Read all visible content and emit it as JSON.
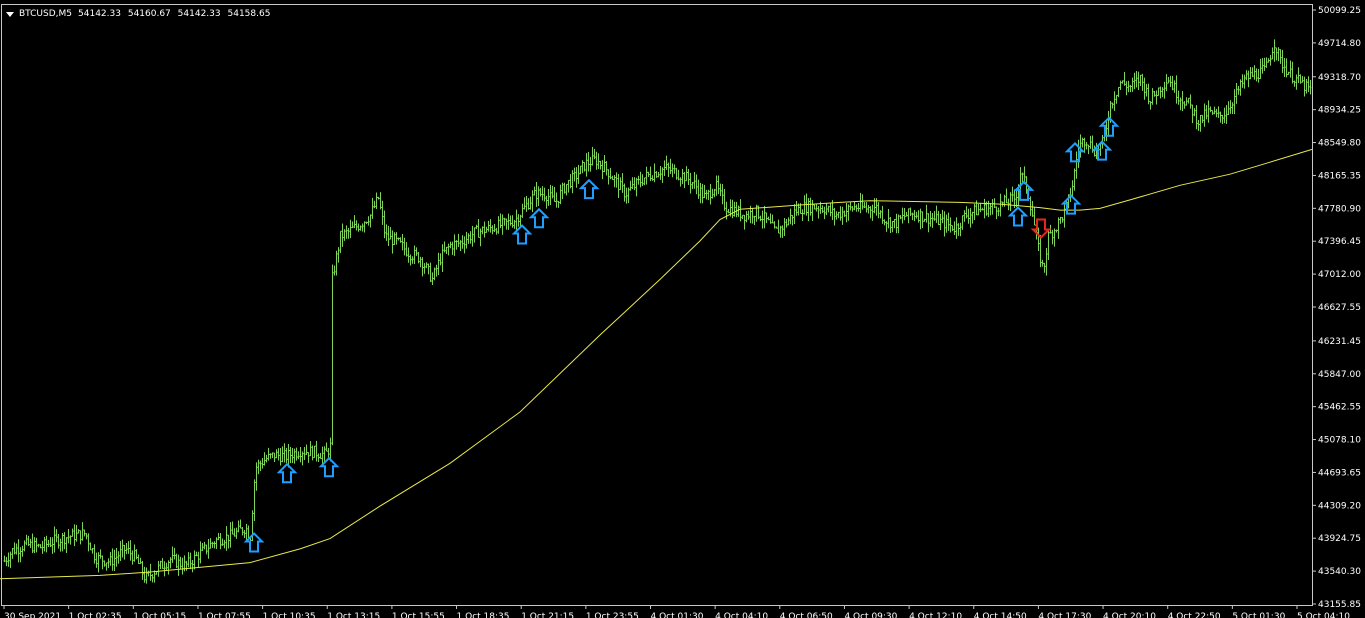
{
  "header": {
    "symbol": "BTCUSD,M5",
    "open": "54142.33",
    "high": "54160.67",
    "low": "54142.33",
    "close": "54158.65"
  },
  "colors": {
    "background": "#000000",
    "frame": "#c8c8c8",
    "text": "#ffffff",
    "bars": "#7fd35a",
    "moving_average": "#e8e84a",
    "buy_arrow": "#1e9fff",
    "sell_arrow": "#e8261e"
  },
  "icons": {
    "buy_signal": "up-arrow-icon",
    "sell_signal": "down-arrow-icon",
    "menu": "triangle-down-icon"
  },
  "chart_data": {
    "type": "ohlc",
    "timeframe": "M5",
    "symbol": "BTCUSD",
    "ylim": [
      43155.85,
      50099.25
    ],
    "y_ticks": [
      "50099.25",
      "49714.80",
      "49318.70",
      "48934.25",
      "48549.80",
      "48165.35",
      "47780.90",
      "47396.45",
      "47012.00",
      "46627.55",
      "46231.45",
      "45847.00",
      "45462.55",
      "45078.10",
      "44693.65",
      "44309.20",
      "43924.75",
      "43540.30",
      "43155.85"
    ],
    "x_ticks": [
      "30 Sep 2021",
      "1 Oct 02:35",
      "1 Oct 05:15",
      "1 Oct 07:55",
      "1 Oct 10:35",
      "1 Oct 13:15",
      "1 Oct 15:55",
      "1 Oct 18:35",
      "1 Oct 21:15",
      "1 Oct 23:55",
      "4 Oct 01:30",
      "4 Oct 04:10",
      "4 Oct 06:50",
      "4 Oct 09:30",
      "4 Oct 12:10",
      "4 Oct 14:50",
      "4 Oct 17:30",
      "4 Oct 20:10",
      "4 Oct 22:50",
      "5 Oct 01:30",
      "5 Oct 04:10"
    ],
    "price_path": [
      [
        0,
        43600
      ],
      [
        12,
        43780
      ],
      [
        25,
        43850
      ],
      [
        40,
        43820
      ],
      [
        55,
        43900
      ],
      [
        70,
        43950
      ],
      [
        85,
        43980
      ],
      [
        95,
        43700
      ],
      [
        110,
        43650
      ],
      [
        125,
        43800
      ],
      [
        135,
        43700
      ],
      [
        145,
        43450
      ],
      [
        155,
        43550
      ],
      [
        170,
        43680
      ],
      [
        185,
        43600
      ],
      [
        200,
        43750
      ],
      [
        215,
        43900
      ],
      [
        230,
        43950
      ],
      [
        245,
        44050
      ],
      [
        250,
        43950
      ],
      [
        255,
        44750
      ],
      [
        265,
        44850
      ],
      [
        275,
        44900
      ],
      [
        285,
        44880
      ],
      [
        300,
        44950
      ],
      [
        315,
        44930
      ],
      [
        325,
        44900
      ],
      [
        330,
        45000
      ],
      [
        331,
        46900
      ],
      [
        340,
        47450
      ],
      [
        350,
        47520
      ],
      [
        360,
        47600
      ],
      [
        370,
        47700
      ],
      [
        378,
        47900
      ],
      [
        385,
        47450
      ],
      [
        395,
        47400
      ],
      [
        410,
        47250
      ],
      [
        420,
        47200
      ],
      [
        432,
        46950
      ],
      [
        440,
        47200
      ],
      [
        450,
        47350
      ],
      [
        460,
        47380
      ],
      [
        475,
        47500
      ],
      [
        490,
        47550
      ],
      [
        505,
        47600
      ],
      [
        515,
        47650
      ],
      [
        525,
        47800
      ],
      [
        535,
        47950
      ],
      [
        545,
        47950
      ],
      [
        555,
        47850
      ],
      [
        565,
        48050
      ],
      [
        575,
        48150
      ],
      [
        585,
        48300
      ],
      [
        595,
        48350
      ],
      [
        605,
        48250
      ],
      [
        615,
        48100
      ],
      [
        625,
        47950
      ],
      [
        635,
        48050
      ],
      [
        645,
        48150
      ],
      [
        655,
        48200
      ],
      [
        665,
        48250
      ],
      [
        675,
        48200
      ],
      [
        685,
        48150
      ],
      [
        695,
        48050
      ],
      [
        705,
        47900
      ],
      [
        715,
        48050
      ],
      [
        725,
        47800
      ],
      [
        735,
        47750
      ],
      [
        745,
        47700
      ],
      [
        755,
        47750
      ],
      [
        765,
        47650
      ],
      [
        775,
        47500
      ],
      [
        785,
        47600
      ],
      [
        795,
        47750
      ],
      [
        805,
        47800
      ],
      [
        815,
        47800
      ],
      [
        825,
        47780
      ],
      [
        835,
        47700
      ],
      [
        845,
        47750
      ],
      [
        855,
        47800
      ],
      [
        865,
        47780
      ],
      [
        875,
        47800
      ],
      [
        885,
        47650
      ],
      [
        895,
        47600
      ],
      [
        905,
        47700
      ],
      [
        915,
        47720
      ],
      [
        925,
        47680
      ],
      [
        935,
        47650
      ],
      [
        945,
        47600
      ],
      [
        955,
        47550
      ],
      [
        965,
        47700
      ],
      [
        975,
        47750
      ],
      [
        985,
        47780
      ],
      [
        995,
        47800
      ],
      [
        1005,
        47850
      ],
      [
        1015,
        47900
      ],
      [
        1020,
        48200
      ],
      [
        1027,
        48000
      ],
      [
        1033,
        47650
      ],
      [
        1038,
        47300
      ],
      [
        1043,
        47050
      ],
      [
        1048,
        47450
      ],
      [
        1055,
        47550
      ],
      [
        1065,
        47750
      ],
      [
        1072,
        48050
      ],
      [
        1078,
        48500
      ],
      [
        1085,
        48600
      ],
      [
        1095,
        48450
      ],
      [
        1103,
        48550
      ],
      [
        1110,
        49000
      ],
      [
        1120,
        49250
      ],
      [
        1130,
        49200
      ],
      [
        1140,
        49300
      ],
      [
        1150,
        49050
      ],
      [
        1160,
        49200
      ],
      [
        1168,
        49300
      ],
      [
        1178,
        49100
      ],
      [
        1188,
        49000
      ],
      [
        1198,
        48800
      ],
      [
        1208,
        48900
      ],
      [
        1218,
        48850
      ],
      [
        1225,
        48900
      ],
      [
        1235,
        49100
      ],
      [
        1245,
        49300
      ],
      [
        1255,
        49350
      ],
      [
        1265,
        49400
      ],
      [
        1274,
        49720
      ],
      [
        1280,
        49500
      ],
      [
        1290,
        49350
      ],
      [
        1300,
        49250
      ],
      [
        1310,
        49150
      ]
    ],
    "moving_average": [
      [
        0,
        43450
      ],
      [
        100,
        43490
      ],
      [
        150,
        43530
      ],
      [
        250,
        43640
      ],
      [
        300,
        43800
      ],
      [
        330,
        43920
      ],
      [
        380,
        44300
      ],
      [
        450,
        44800
      ],
      [
        520,
        45400
      ],
      [
        600,
        46300
      ],
      [
        660,
        46950
      ],
      [
        700,
        47400
      ],
      [
        720,
        47650
      ],
      [
        740,
        47770
      ],
      [
        800,
        47820
      ],
      [
        840,
        47850
      ],
      [
        870,
        47870
      ],
      [
        920,
        47860
      ],
      [
        960,
        47850
      ],
      [
        1000,
        47830
      ],
      [
        1040,
        47790
      ],
      [
        1060,
        47760
      ],
      [
        1080,
        47760
      ],
      [
        1100,
        47780
      ],
      [
        1130,
        47880
      ],
      [
        1180,
        48050
      ],
      [
        1230,
        48180
      ],
      [
        1270,
        48320
      ],
      [
        1312,
        48470
      ]
    ],
    "buy_arrows": [
      {
        "x": 254,
        "price": 43980
      },
      {
        "x": 287,
        "price": 44790
      },
      {
        "x": 329,
        "price": 44860
      },
      {
        "x": 522,
        "price": 47580
      },
      {
        "x": 539,
        "price": 47770
      },
      {
        "x": 589,
        "price": 48110
      },
      {
        "x": 1018,
        "price": 47790
      },
      {
        "x": 1024,
        "price": 48090
      },
      {
        "x": 1071,
        "price": 47930
      },
      {
        "x": 1075,
        "price": 48540
      },
      {
        "x": 1102,
        "price": 48560
      },
      {
        "x": 1109,
        "price": 48840
      }
    ],
    "sell_arrows": [
      {
        "x": 1041,
        "price": 47440
      }
    ]
  }
}
